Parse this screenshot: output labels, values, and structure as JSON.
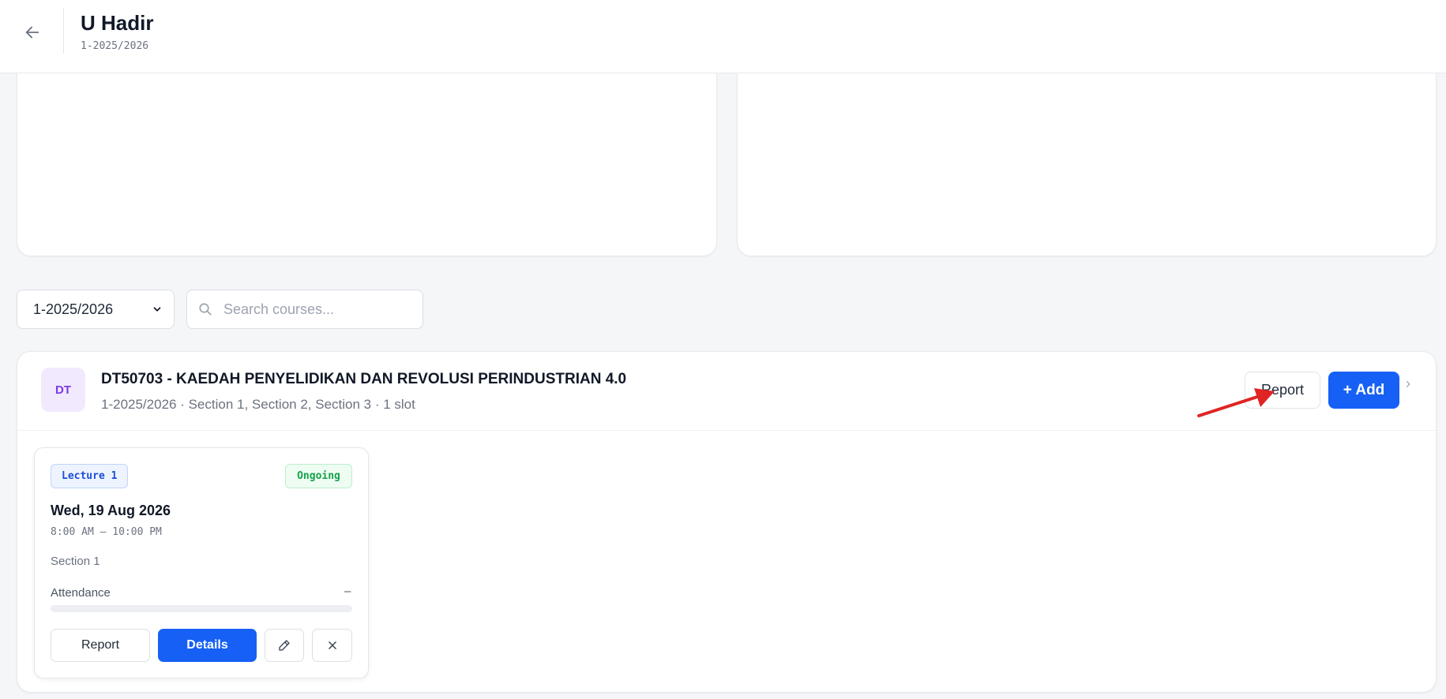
{
  "header": {
    "title": "U Hadir",
    "subtitle": "1-2025/2026",
    "back_icon": "arrow-left-icon"
  },
  "filters": {
    "semester_value": "1-2025/2026",
    "search_placeholder": "Search courses...",
    "search_value": ""
  },
  "course": {
    "avatar": "DT",
    "title": "DT50703 - KAEDAH PENYELIDIKAN DAN REVOLUSI PERINDUSTRIAN 4.0",
    "meta": "1-2025/2026 · Section 1, Section 2, Section 3 · 1 slot",
    "report_label": "Report",
    "add_label": "+ Add",
    "chevron": "›"
  },
  "slot": {
    "badge": "Lecture 1",
    "status": "Ongoing",
    "date": "Wed, 19 Aug 2026",
    "time": "8:00 AM — 10:00 PM",
    "section": "Section 1",
    "attendance_label": "Attendance",
    "attendance_value": "–",
    "attendance_fraction": 0,
    "report_label": "Report",
    "details_label": "Details",
    "edit_icon": "pencil-icon",
    "delete_icon": "close-icon"
  },
  "colors": {
    "primary": "#1660f5",
    "annotation_arrow": "#e02424",
    "avatar_bg": "#f1e9fd",
    "avatar_text": "#7c3aed",
    "ongoing": "#15a34a",
    "lecture": "#1d4ed8"
  }
}
